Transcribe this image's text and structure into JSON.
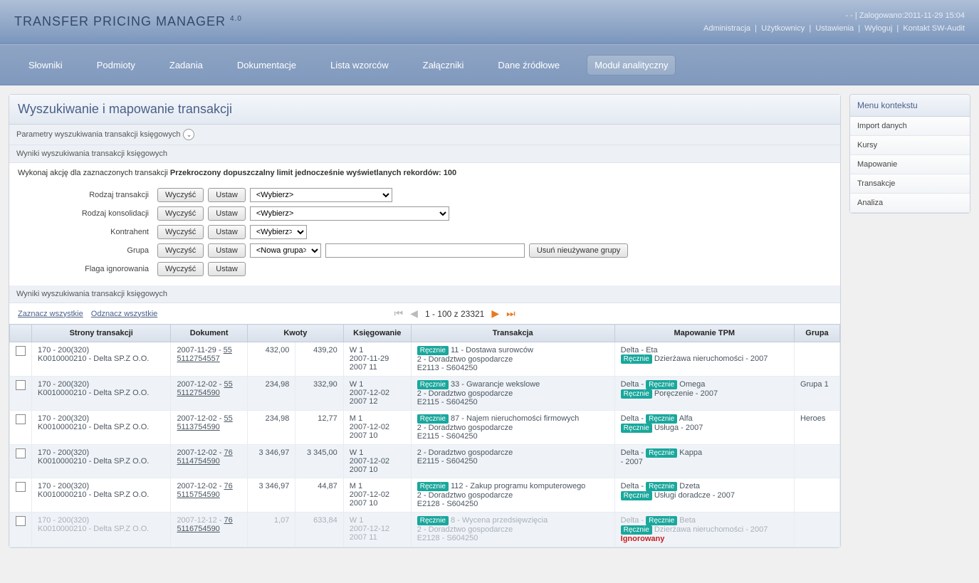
{
  "header": {
    "app_name": "TRANSFER PRICING MANAGER",
    "app_version": "4.0",
    "login_info": "-  - | Zalogowano:2011-11-29 15:04",
    "top_links": [
      "Administracja",
      "Użytkownicy",
      "Ustawienia",
      "Wyloguj",
      "Kontakt SW-Audit"
    ]
  },
  "nav": {
    "items": [
      "Słowniki",
      "Podmioty",
      "Zadania",
      "Dokumentacje",
      "Lista wzorców",
      "Załączniki",
      "Dane źródłowe",
      "Moduł analityczny"
    ],
    "active_index": 7
  },
  "panel": {
    "title": "Wyszukiwanie i mapowanie transakcji",
    "params_label": "Parametry wyszukiwania transakcji księgowych",
    "results_label": "Wyniki wyszukiwania transakcji księgowych",
    "action_prefix": "Wykonaj akcję dla zaznaczonych transakcji ",
    "action_bold": "Przekroczony dopuszczalny limit jednocześnie wyświetlanych rekordów: 100"
  },
  "form": {
    "rows": [
      {
        "label": "Rodzaj transakcji",
        "clear": "Wyczyść",
        "set": "Ustaw",
        "select": "<Wybierz>"
      },
      {
        "label": "Rodzaj konsolidacji",
        "clear": "Wyczyść",
        "set": "Ustaw",
        "select": "<Wybierz>"
      },
      {
        "label": "Kontrahent",
        "clear": "Wyczyść",
        "set": "Ustaw",
        "select": "<Wybierz>"
      },
      {
        "label": "Grupa",
        "clear": "Wyczyść",
        "set": "Ustaw",
        "select": "<Nowa grupa>",
        "extra_btn": "Usuń nieużywane grupy"
      },
      {
        "label": "Flaga ignorowania",
        "clear": "Wyczyść",
        "set": "Ustaw"
      }
    ]
  },
  "results": {
    "select_all": "Zaznacz wszystkie",
    "deselect_all": "Odznacz wszystkie",
    "pager_text": "1 - 100  z  23321"
  },
  "table": {
    "headers": [
      "",
      "Strony transakcji",
      "Dokument",
      "Kwoty",
      "",
      "Księgowanie",
      "Transakcja",
      "Mapowanie TPM",
      "Grupa"
    ],
    "rows": [
      {
        "strony": "170 - 200(320)\nK0010000210 - Delta SP.Z O.O.",
        "dok_date": "2007-11-29 - ",
        "dok_num": "55",
        "dok_link": "5112754557",
        "k1": "432,00",
        "k2": "439,20",
        "ksieg": "W 1\n2007-11-29\n2007 11",
        "trans_tag": "Ręcznie",
        "trans": "11 -  Dostawa surowców\n2 -  Doradztwo gospodarcze\nE2113 -  S604250",
        "map": "Delta  -  Eta",
        "map_tag": "Ręcznie",
        "map2": "Dzierżawa nieruchomości  -  2007",
        "grupa": ""
      },
      {
        "strony": "170 - 200(320)\nK0010000210 - Delta SP.Z O.O.",
        "dok_date": "2007-12-02 - ",
        "dok_num": "55",
        "dok_link": "5112754590",
        "k1": "234,98",
        "k2": "332,90",
        "ksieg": "W 1\n2007-12-02\n2007 12",
        "trans_tag": "Ręcznie",
        "trans": "33 -  Gwarancje wekslowe\n2 -  Doradztwo gospodarcze\nE2115 -  S604250",
        "map": "Delta  - ",
        "map_inline_tag": "Ręcznie",
        "map_after": "Omega",
        "map_tag": "Ręcznie",
        "map2": "Poręczenie  -  2007",
        "grupa": "Grupa 1"
      },
      {
        "strony": "170 - 200(320)\nK0010000210 - Delta SP.Z O.O.",
        "dok_date": "2007-12-02 - ",
        "dok_num": "55",
        "dok_link": "5113754590",
        "k1": "234,98",
        "k2": "12,77",
        "ksieg": "M 1\n2007-12-02\n2007 10",
        "trans_tag": "Ręcznie",
        "trans": "87 -  Najem nieruchomości firmowych\n2 -  Doradztwo gospodarcze\nE2115 -  S604250",
        "map": "Delta  - ",
        "map_inline_tag": "Ręcznie",
        "map_after": "Alfa",
        "map_tag": "Ręcznie",
        "map2": "Usługa  -  2007",
        "grupa": "Heroes"
      },
      {
        "strony": "170 - 200(320)\nK0010000210 - Delta SP.Z O.O.",
        "dok_date": "2007-12-02 - ",
        "dok_num": "76",
        "dok_link": "5114754590",
        "k1": "3 346,97",
        "k2": "3 345,00",
        "ksieg": "W 1\n2007-12-02\n2007 10",
        "trans": "2 -  Doradztwo gospodarcze\nE2115 -  S604250",
        "map": "Delta  - ",
        "map_inline_tag": "Ręcznie",
        "map_after": "Kappa",
        "map2": " -  2007",
        "grupa": ""
      },
      {
        "strony": "170 - 200(320)\nK0010000210 - Delta SP.Z O.O.",
        "dok_date": "2007-12-02 - ",
        "dok_num": "76",
        "dok_link": "5115754590",
        "k1": "3 346,97",
        "k2": "44,87",
        "ksieg": "M 1\n2007-12-02\n2007 10",
        "trans_tag": "Ręcznie",
        "trans": "112 -  Zakup programu komputerowego\n2 -  Doradztwo gospodarcze\nE2128 -  S604250",
        "map": "Delta  - ",
        "map_inline_tag": "Ręcznie",
        "map_after": "Dzeta",
        "map_tag": "Ręcznie",
        "map2": "Usługi doradcze  -  2007",
        "grupa": ""
      },
      {
        "muted": true,
        "strony": "170 - 200(320)\nK0010000210 - Delta SP.Z O.O.",
        "dok_date": "2007-12-12 - ",
        "dok_num": "76",
        "dok_link": "5116754590",
        "k1": "1,07",
        "k2": "633,84",
        "ksieg": "W 1\n2007-12-12\n2007 11",
        "trans_tag": "Ręcznie",
        "trans": "8 -  Wycena przedsięwzięcia\n2 -  Doradztwo gospodarcze\nE2128 -  S604250",
        "map": "Delta  - ",
        "map_inline_tag": "Ręcznie",
        "map_after": "Beta",
        "map_tag": "Ręcznie",
        "map2": "Dzierżawa nieruchomości  -  2007",
        "ignored": "Ignorowany",
        "grupa": ""
      }
    ]
  },
  "sidebar": {
    "title": "Menu kontekstu",
    "items": [
      "Import danych",
      "Kursy",
      "Mapowanie",
      "Transakcje",
      "Analiza"
    ]
  }
}
